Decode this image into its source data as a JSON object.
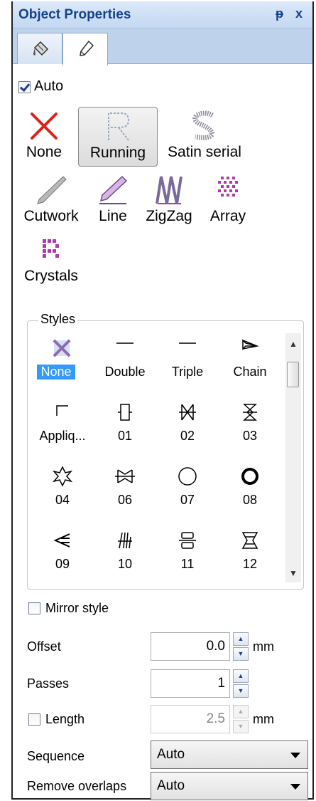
{
  "panel": {
    "title": "Object Properties",
    "pin_glyph": "ᵽ",
    "close_glyph": "x"
  },
  "tabs": [
    {
      "icon": "paint-bucket-icon"
    },
    {
      "icon": "pen-nib-icon",
      "active": true
    }
  ],
  "auto": {
    "label": "Auto",
    "checked": true
  },
  "stitch_types": [
    {
      "label": "None",
      "icon": "red-cross-icon"
    },
    {
      "label": "Running",
      "icon": "running-stitch-icon",
      "selected": true
    },
    {
      "label": "Satin serial",
      "icon": "satin-serial-icon"
    },
    {
      "label": "Cutwork",
      "icon": "cutwork-knife-icon"
    },
    {
      "label": "Line",
      "icon": "line-stitch-icon"
    },
    {
      "label": "ZigZag",
      "icon": "zigzag-stitch-icon"
    },
    {
      "label": "Array",
      "icon": "array-dots-icon"
    },
    {
      "label": "Crystals",
      "icon": "crystals-icon"
    }
  ],
  "styles": {
    "title": "Styles",
    "items": [
      {
        "label": "None",
        "icon": "purple-cross-icon",
        "selected": true
      },
      {
        "label": "Double",
        "icon": "double-line-icon"
      },
      {
        "label": "Triple",
        "icon": "triple-line-icon"
      },
      {
        "label": "Chain",
        "icon": "chain-icon"
      },
      {
        "label": "Appliq...",
        "icon": "applique-icon"
      },
      {
        "label": "01",
        "icon": "style-01-icon"
      },
      {
        "label": "02",
        "icon": "style-02-icon"
      },
      {
        "label": "03",
        "icon": "style-03-icon"
      },
      {
        "label": "04",
        "icon": "style-04-icon"
      },
      {
        "label": "06",
        "icon": "style-06-icon"
      },
      {
        "label": "07",
        "icon": "style-07-icon"
      },
      {
        "label": "08",
        "icon": "style-08-icon"
      },
      {
        "label": "09",
        "icon": "style-09-icon"
      },
      {
        "label": "10",
        "icon": "style-10-icon"
      },
      {
        "label": "11",
        "icon": "style-11-icon"
      },
      {
        "label": "12",
        "icon": "style-12-icon"
      }
    ]
  },
  "mirror_style": {
    "label": "Mirror style",
    "checked": false
  },
  "offset": {
    "label": "Offset",
    "value": "0.0",
    "unit": "mm"
  },
  "passes": {
    "label": "Passes",
    "value": "1"
  },
  "length": {
    "label": "Length",
    "value": "2.5",
    "unit": "mm",
    "checked": false
  },
  "sequence": {
    "label": "Sequence",
    "value": "Auto"
  },
  "remove_overlaps": {
    "label": "Remove overlaps",
    "value": "Auto"
  },
  "colors": {
    "accent": "#15428b",
    "selection": "#3399ff",
    "stitch_purple": "#b03aa8",
    "cross_red": "#e0201c"
  }
}
